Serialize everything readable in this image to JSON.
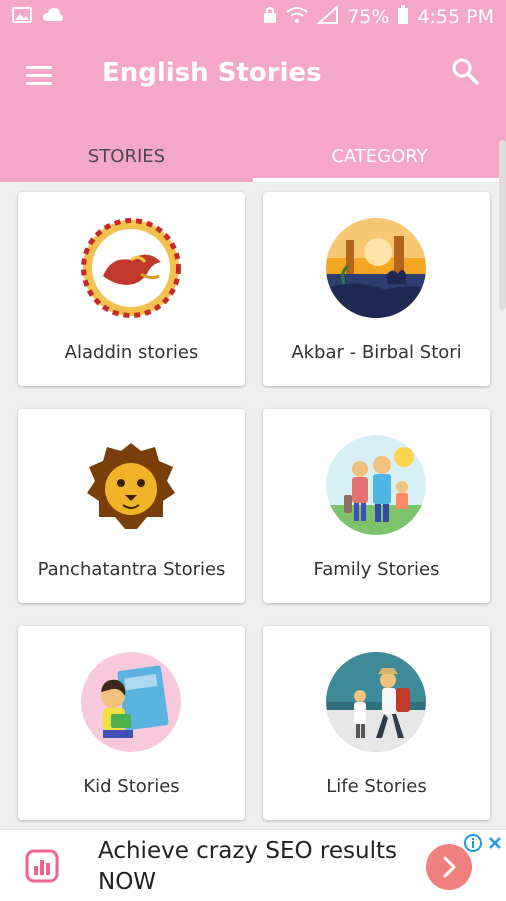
{
  "status_bar": {
    "battery": "75%",
    "time": "4:55 PM",
    "left_icons": [
      "image-icon",
      "cloud-icon"
    ],
    "right_icons": [
      "lock-icon",
      "wifi-icon",
      "signal-icon",
      "battery-icon"
    ]
  },
  "app_bar": {
    "title": "English Stories",
    "menu_icon": "menu-icon",
    "search_icon": "search-icon",
    "color": "#f4a7c9"
  },
  "tabs": [
    {
      "label": "STORIES",
      "active": false
    },
    {
      "label": "CATEGORY",
      "active": true
    }
  ],
  "categories": [
    {
      "label": "Aladdin stories",
      "icon": "aladdin-lamp-icon"
    },
    {
      "label": "Akbar - Birbal Stori",
      "icon": "camel-desert-icon"
    },
    {
      "label": "Panchatantra Stories",
      "icon": "lion-face-icon"
    },
    {
      "label": "Family Stories",
      "icon": "family-icon"
    },
    {
      "label": "Kid Stories",
      "icon": "kid-reading-icon"
    },
    {
      "label": "Life Stories",
      "icon": "traveler-icon"
    }
  ],
  "ad": {
    "text": "Achieve crazy SEO results NOW",
    "logo_icon": "chart-logo-icon",
    "go_icon": "chevron-right-icon",
    "info_icon": "info-icon",
    "close_icon": "close-icon"
  }
}
